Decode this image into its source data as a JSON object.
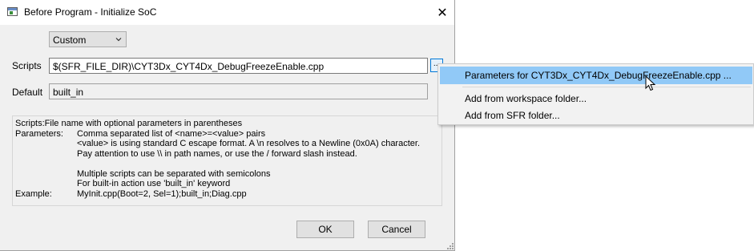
{
  "window": {
    "title": "Before Program - Initialize SoC",
    "close_glyph": "✕"
  },
  "preset": {
    "selected": "Custom"
  },
  "scripts": {
    "label": "Scripts",
    "value": "$(SFR_FILE_DIR)\\CYT3Dx_CYT4Dx_DebugFreezeEnable.cpp",
    "button_label": "..."
  },
  "default": {
    "label": "Default",
    "value": "built_in"
  },
  "help": {
    "line1": "Scripts:File name with optional parameters in parentheses",
    "params_key": "Parameters:",
    "params_lines": [
      "Comma separated list of <name>=<value> pairs",
      "<value> is using standard C escape format. A \\n resolves to a Newline (0x0A) character.",
      "Pay attention to use \\\\ in path names, or use the / forward slash instead.",
      "",
      "Multiple scripts can be separated with semicolons",
      "For built-in action use 'built_in' keyword"
    ],
    "example_key": "Example:",
    "example_value": "MyInit.cpp(Boot=2, Sel=1);built_in;Diag.cpp"
  },
  "buttons": {
    "ok": "OK",
    "cancel": "Cancel"
  },
  "context_menu": {
    "items": [
      "Parameters for CYT3Dx_CYT4Dx_DebugFreezeEnable.cpp ...",
      "Add from workspace folder...",
      "Add from SFR folder..."
    ]
  },
  "colors": {
    "menu_highlight": "#91c9f7",
    "focus_border": "#0078d7"
  }
}
